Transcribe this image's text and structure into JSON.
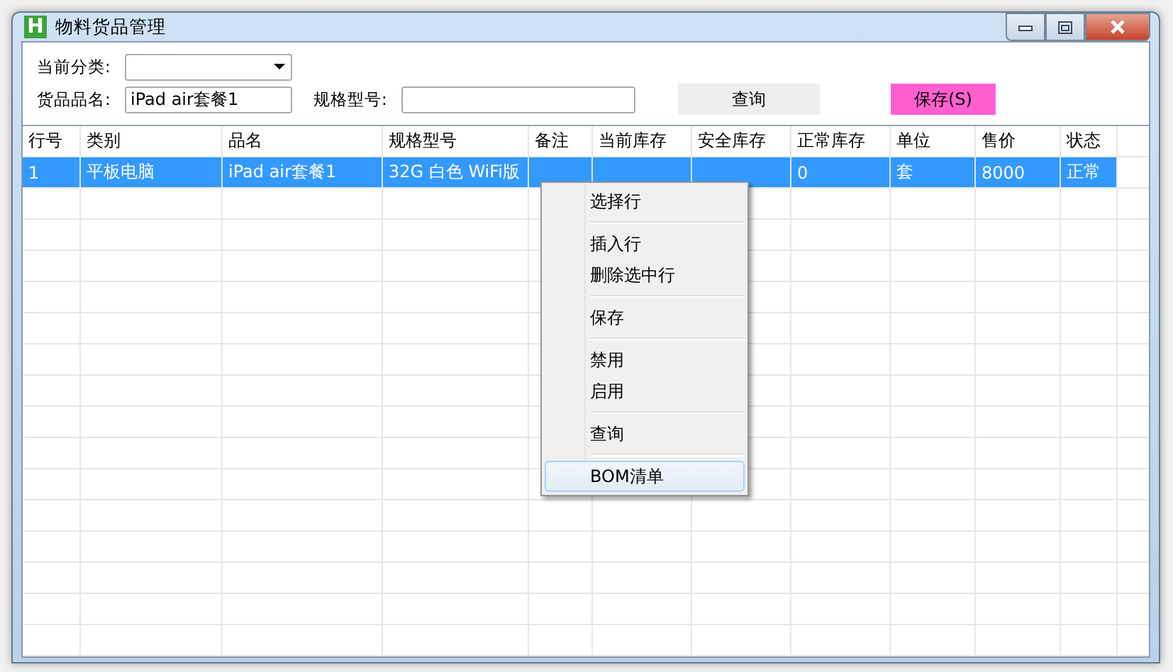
{
  "window": {
    "title": "物料货品管理",
    "icon_letter": "H"
  },
  "form": {
    "category_label": "当前分类:",
    "name_label": "货品品名:",
    "name_value": "iPad air套餐1",
    "spec_label": "规格型号:",
    "query_button": "查询",
    "save_button": "保存(S)"
  },
  "table": {
    "columns": [
      "行号",
      "类别",
      "品名",
      "规格型号",
      "备注",
      "当前库存",
      "安全库存",
      "正常库存",
      "单位",
      "售价",
      "状态"
    ],
    "rows": [
      {
        "selected": true,
        "cells": [
          "1",
          "平板电脑",
          "iPad air套餐1",
          "32G 白色 WiFi版",
          null,
          null,
          null,
          "0",
          "套",
          "8000",
          "正常"
        ]
      }
    ]
  },
  "context_menu": {
    "groups": [
      [
        {
          "label": "选择行",
          "selected": false
        }
      ],
      [
        {
          "label": "插入行",
          "selected": false
        },
        {
          "label": "删除选中行",
          "selected": false
        }
      ],
      [
        {
          "label": "保存",
          "selected": false
        }
      ],
      [
        {
          "label": "禁用",
          "selected": false
        },
        {
          "label": "启用",
          "selected": false
        }
      ],
      [
        {
          "label": "查询",
          "selected": false
        }
      ],
      [
        {
          "label": "BOM清单",
          "selected": true
        }
      ]
    ]
  }
}
